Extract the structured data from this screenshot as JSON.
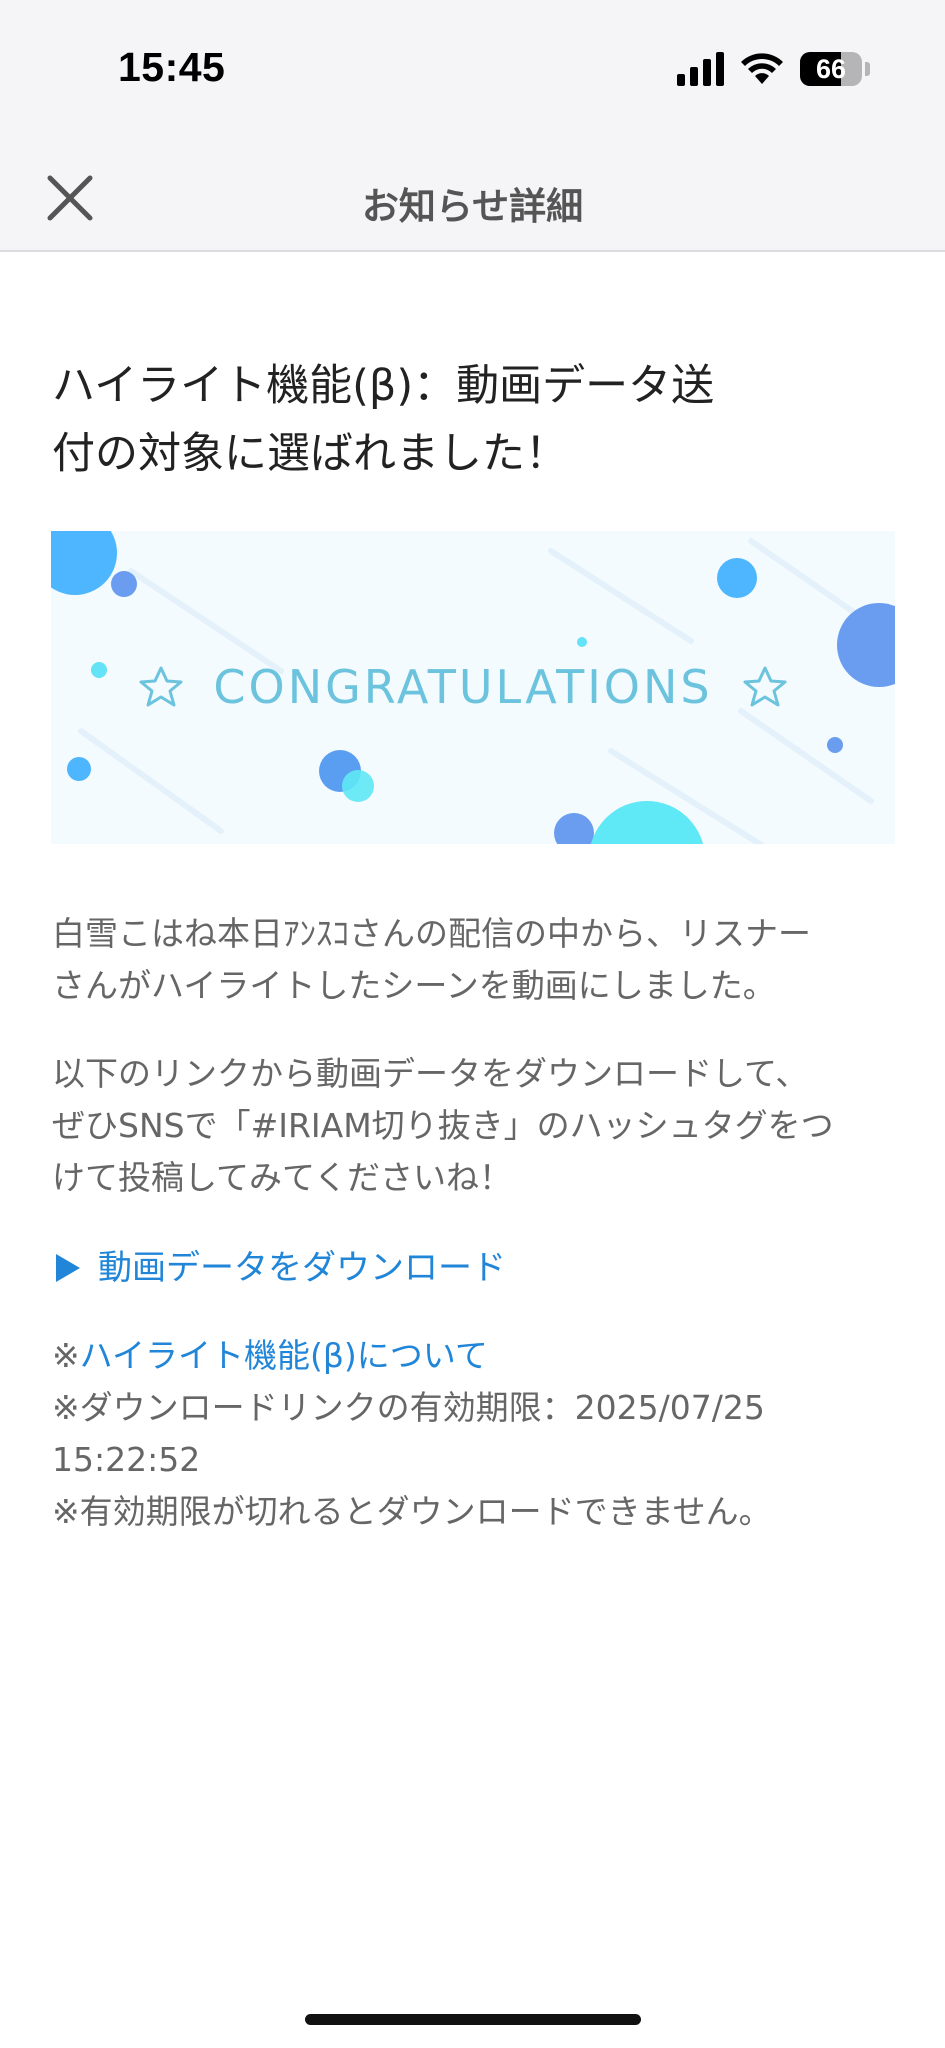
{
  "status_bar": {
    "time": "15:45",
    "battery_level": "66",
    "battery_fraction": 0.66,
    "icons": [
      "signal-icon",
      "wifi-icon",
      "battery-icon"
    ]
  },
  "nav": {
    "title": "お知らせ詳細",
    "close_icon": "close-icon"
  },
  "article": {
    "title_line1": "ハイライト機能(β)：動画データ送",
    "title_line2": "付の対象に選ばれました！",
    "banner_text": "CONGRATULATIONS",
    "para1_line1": "白雪こはね本日ｱﾝｽｺさんの配信の中から、リスナー",
    "para1_line2": "さんがハイライトしたシーンを動画にしました。",
    "para2_line1": "以下のリンクから動画データをダウンロードして、",
    "para2_line2": "ぜひSNSで「#IRIAM切り抜き」のハッシュタグをつ",
    "para2_line3": "けて投稿してみてくださいね！",
    "download_link": "動画データをダウンロード",
    "note_prefix": "※",
    "note_link": "ハイライト機能(β)について",
    "note_expiry_line1": "※ダウンロードリンクの有効期限：2025/07/25",
    "note_expiry_line2": "15:22:52",
    "note_expired": "※有効期限が切れるとダウンロードできません。"
  },
  "colors": {
    "link": "#2185d8",
    "banner_bg": "#f3fbfe",
    "banner_text": "#6cc3dd",
    "bubble_blue": "#5aa0f2",
    "bubble_cyan": "#55e6f5"
  }
}
